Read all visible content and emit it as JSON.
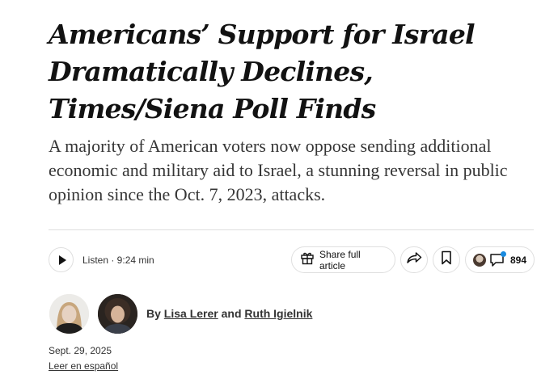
{
  "article": {
    "headline": "Americans’ Support for Israel Dramatically Declines, Times/Siena Poll Finds",
    "summary": "A majority of American voters now oppose sending additional economic and military aid to Israel, a stunning reversal in public opinion since the Oct. 7, 2023, attacks."
  },
  "toolbar": {
    "listen_label": "Listen · 9:24 min",
    "share_full_label": "Share full article",
    "comment_count": "894",
    "icons": {
      "play": "play-icon",
      "gift": "gift-icon",
      "share": "share-arrow-icon",
      "save": "bookmark-icon",
      "comments": "comment-bubble-icon"
    },
    "notification_color": "#1a8be0"
  },
  "byline": {
    "prefix": "By",
    "author_1": "Lisa Lerer",
    "conjunction": "and",
    "author_2": "Ruth Igielnik"
  },
  "meta": {
    "date": "Sept. 29, 2025",
    "spanish_link": "Leer en español"
  }
}
